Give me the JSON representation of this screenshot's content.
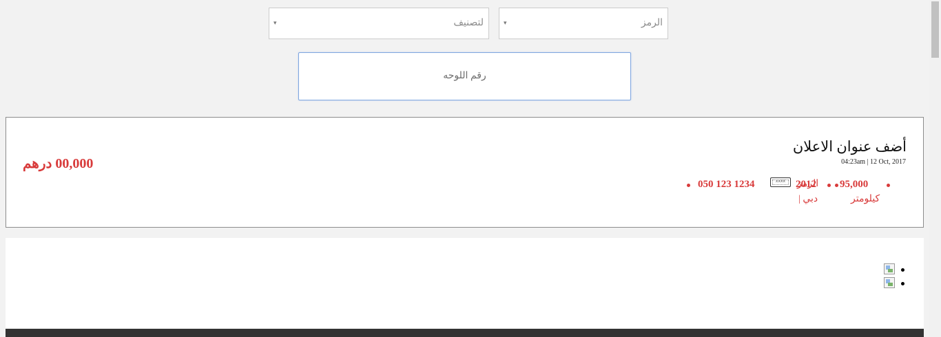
{
  "filters": {
    "code_label": "الرمز",
    "category_label": "لتصنيف",
    "caret": "▾"
  },
  "plate_search": {
    "placeholder": "رقم اللوحه"
  },
  "listing": {
    "title": "أضف عنوان الاعلان",
    "date": "04:23am | 12 Oct, 2017",
    "price": "00,000 درهم",
    "mileage_value": "95,000",
    "mileage_unit": "كيلومتر",
    "year": "2012",
    "code_prefix": "الرمز",
    "plate_icon_text": "xxxx",
    "city": "| دبي",
    "phone": "050 123 1234"
  },
  "colors": {
    "accent_red": "#d83a3a",
    "focus_blue": "#7fa6e0",
    "background": "#f2f2f2"
  }
}
